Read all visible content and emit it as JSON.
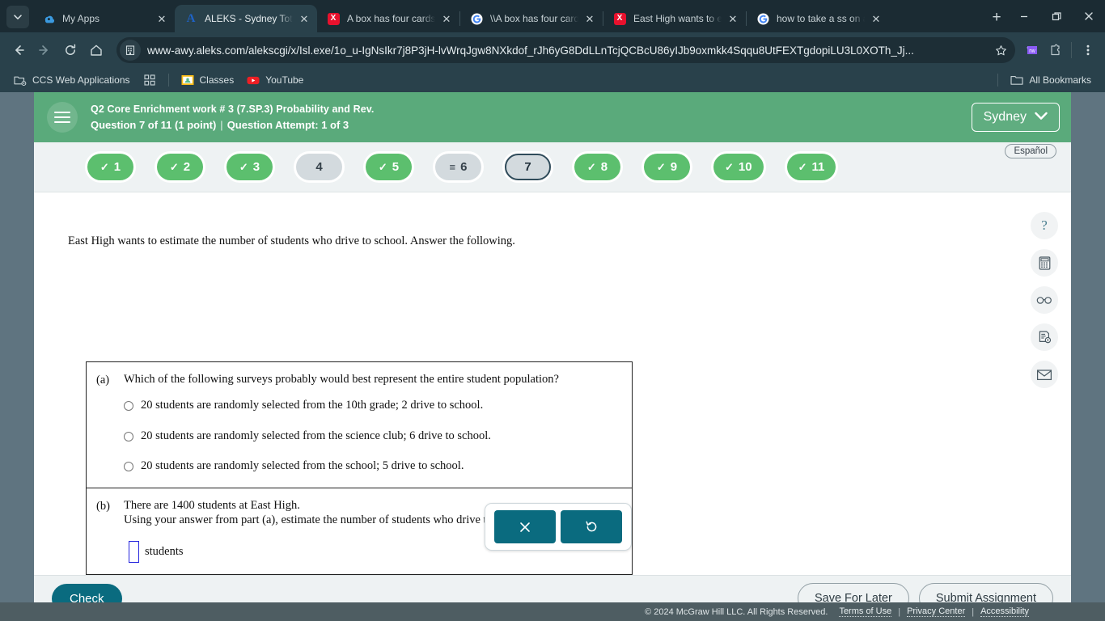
{
  "browser": {
    "tab_list_icon": "chevron-down-icon",
    "tabs": [
      {
        "title": "My Apps",
        "favicon": "myapps-icon",
        "active": false
      },
      {
        "title": "ALEKS - Sydney Tottenh",
        "favicon": "aleks-icon",
        "active": true
      },
      {
        "title": "A box has four cards n",
        "favicon": "mathway-icon",
        "active": false
      },
      {
        "title": "\\\\A box has four cards",
        "favicon": "google-icon",
        "active": false
      },
      {
        "title": "East High wants to est",
        "favicon": "mathway-icon",
        "active": false
      },
      {
        "title": "how to take a ss on a c",
        "favicon": "google-icon",
        "active": false
      }
    ],
    "new_tab_label": "+",
    "window_controls": {
      "minimize": "–",
      "maximize": "restore-icon",
      "close": "✕"
    },
    "nav": {
      "back": "back-arrow-icon",
      "forward": "forward-arrow-icon",
      "reload": "reload-icon",
      "home": "home-icon"
    },
    "url": "www-awy.aleks.com/alekscgi/x/Isl.exe/1o_u-IgNsIkr7j8P3jH-lvWrqJgw8NXkdof_rJh6yG8DdLLnTcjQCBcU86yIJb9oxmkk4Sqqu8UtFEXTgdopiLU3L0XOTh_Jj...",
    "site_icon": "site-info-icon",
    "bookmark_star": "star-icon",
    "extensions": [
      {
        "name": "rw-extension-icon",
        "label": "rw"
      },
      {
        "name": "extensions-puzzle-icon"
      }
    ],
    "menu_icon": "three-dot-menu-icon",
    "bookmarks": [
      {
        "label": "CCS Web Applications",
        "icon": "folder-settings-icon"
      },
      {
        "label": "",
        "icon": "apps-grid-icon"
      },
      {
        "label": "Classes",
        "icon": "google-classroom-icon"
      },
      {
        "label": "YouTube",
        "icon": "youtube-icon"
      }
    ],
    "all_bookmarks_label": "All Bookmarks",
    "all_bookmarks_icon": "folder-icon"
  },
  "header": {
    "menu_icon": "hamburger-menu-icon",
    "assignment_title": "Q2 Core Enrichment work # 3 (7.SP.3) Probability and Rev.",
    "question_progress": "Question 7 of 11 (1 point)",
    "separator": "|",
    "attempt": "Question Attempt: 1 of 3",
    "user_name": "Sydney",
    "user_chevron": "chevron-down-icon",
    "bg_color": "#5aaa7b"
  },
  "question_nav": {
    "espanol_label": "Español",
    "pills": [
      {
        "label": "1",
        "state": "done",
        "mark": "✓"
      },
      {
        "label": "2",
        "state": "done",
        "mark": "✓"
      },
      {
        "label": "3",
        "state": "done",
        "mark": "✓"
      },
      {
        "label": "4",
        "state": "todo",
        "mark": ""
      },
      {
        "label": "5",
        "state": "done",
        "mark": "✓"
      },
      {
        "label": "6",
        "state": "partial",
        "mark": "≡"
      },
      {
        "label": "7",
        "state": "current",
        "mark": ""
      },
      {
        "label": "8",
        "state": "done",
        "mark": "✓"
      },
      {
        "label": "9",
        "state": "done",
        "mark": "✓"
      },
      {
        "label": "10",
        "state": "done",
        "mark": "✓"
      },
      {
        "label": "11",
        "state": "done",
        "mark": "✓"
      }
    ],
    "done_color": "#5cbf6e",
    "todo_color": "#d3dade"
  },
  "question": {
    "prompt": "East High wants to estimate the number of students who drive to school. Answer the following.",
    "part_a": {
      "label": "(a)",
      "text": "Which of the following surveys probably would best represent the entire student population?",
      "choices": [
        "20 students are randomly selected from the 10th grade; 2 drive to school.",
        "20 students are randomly selected from the science club; 6 drive to school.",
        "20 students are randomly selected from the school; 5 drive to school."
      ]
    },
    "part_b": {
      "label": "(b)",
      "line1": "There are 1400 students at East High.",
      "line2": "Using your answer from part (a), estimate the number of students who drive to school.",
      "answer_value": "",
      "answer_unit": "students"
    }
  },
  "math_toolbar": {
    "clear_icon": "x-clear-icon",
    "undo_icon": "undo-refresh-icon",
    "button_color": "#0a6b7f"
  },
  "rail": [
    {
      "name": "help-icon",
      "glyph": "?"
    },
    {
      "name": "calculator-icon",
      "glyph": ""
    },
    {
      "name": "glasses-icon",
      "glyph": ""
    },
    {
      "name": "reference-sheet-icon",
      "glyph": ""
    },
    {
      "name": "email-icon",
      "glyph": ""
    }
  ],
  "actions": {
    "check_label": "Check",
    "save_for_later_label": "Save For Later",
    "submit_assignment_label": "Submit Assignment",
    "check_color": "#0a6b7f"
  },
  "footer": {
    "copyright": "© 2024 McGraw Hill LLC. All Rights Reserved.",
    "links": [
      "Terms of Use",
      "Privacy Center",
      "Accessibility"
    ],
    "separator": "|"
  }
}
